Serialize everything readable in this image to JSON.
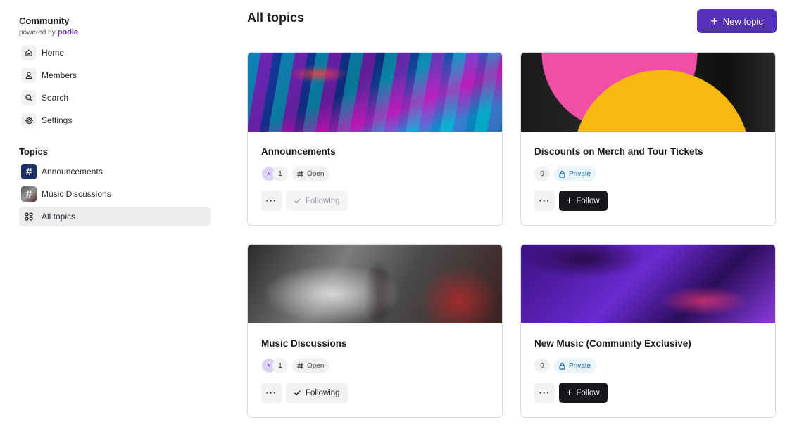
{
  "brand": {
    "title": "Community",
    "powered_by": "powered by",
    "logo_text": "podia"
  },
  "nav": [
    {
      "label": "Home",
      "icon": "home-icon"
    },
    {
      "label": "Members",
      "icon": "user-icon"
    },
    {
      "label": "Search",
      "icon": "search-icon"
    },
    {
      "label": "Settings",
      "icon": "gear-icon"
    }
  ],
  "topics_section": {
    "title": "Topics",
    "items": [
      {
        "label": "Announcements",
        "icon": "hash-icon"
      },
      {
        "label": "Music Discussions",
        "icon": "hash-icon"
      },
      {
        "label": "All topics",
        "icon": "grid-icon",
        "active": true
      }
    ]
  },
  "header": {
    "title": "All topics",
    "new_topic_label": "New topic"
  },
  "cards": [
    {
      "name": "Announcements",
      "avatar_initial": "N",
      "count": "1",
      "visibility": "Open",
      "follow_state": "Following",
      "follow_muted": true
    },
    {
      "name": "Discounts on Merch and Tour Tickets",
      "count": "0",
      "visibility": "Private",
      "follow_state": "Follow"
    },
    {
      "name": "Music Discussions",
      "avatar_initial": "N",
      "count": "1",
      "visibility": "Open",
      "follow_state": "Following",
      "follow_muted": false
    },
    {
      "name": "New Music (Community Exclusive)",
      "count": "0",
      "visibility": "Private",
      "follow_state": "Follow"
    }
  ],
  "colors": {
    "accent": "#5530b8",
    "follow_btn": "#17181c",
    "private_text": "#1c6b93"
  }
}
